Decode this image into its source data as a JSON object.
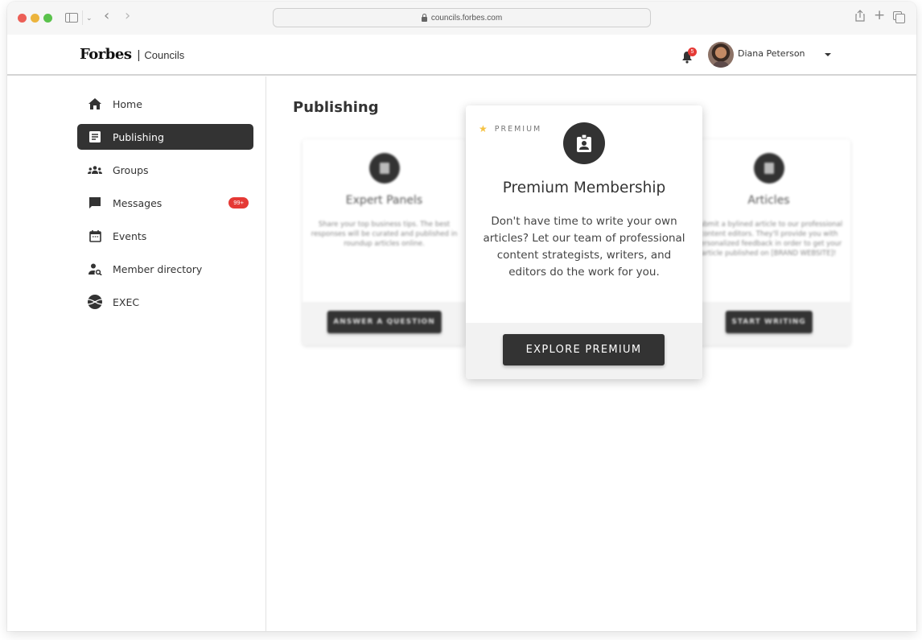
{
  "browser": {
    "url": "councils.forbes.com"
  },
  "header": {
    "logo_brand": "Forbes",
    "logo_separator": "|",
    "logo_product": "Councils",
    "notification_count": "5",
    "user_name": "Diana Peterson"
  },
  "sidebar": {
    "items": [
      {
        "label": "Home",
        "icon": "home-icon"
      },
      {
        "label": "Publishing",
        "icon": "article-icon",
        "active": true
      },
      {
        "label": "Groups",
        "icon": "groups-icon"
      },
      {
        "label": "Messages",
        "icon": "chat-icon",
        "badge": "99+"
      },
      {
        "label": "Events",
        "icon": "calendar-icon"
      },
      {
        "label": "Member directory",
        "icon": "person-search-icon"
      },
      {
        "label": "EXEC",
        "icon": "exec-icon"
      }
    ]
  },
  "main": {
    "title": "Publishing",
    "cards": [
      {
        "title": "Expert Panels",
        "description": "Share your top business tips. The best responses will be curated and published in roundup articles online.",
        "button": "ANSWER A QUESTION"
      },
      {
        "title": "Articles",
        "description": "Submit a bylined article to our professional content editors. They'll provide you with personalized feedback in order to get your article published on [BRAND WEBSITE]!",
        "button": "START WRITING"
      }
    ],
    "premium": {
      "tag": "PREMIUM",
      "title": "Premium Membership",
      "description": "Don't have time to write your own articles? Let our team of professional content strategists, writers, and editors do the work for you.",
      "button": "EXPLORE PREMIUM",
      "accent_color": "#f5c242"
    }
  },
  "colors": {
    "primary_dark": "#333333",
    "badge_red": "#e53935"
  }
}
